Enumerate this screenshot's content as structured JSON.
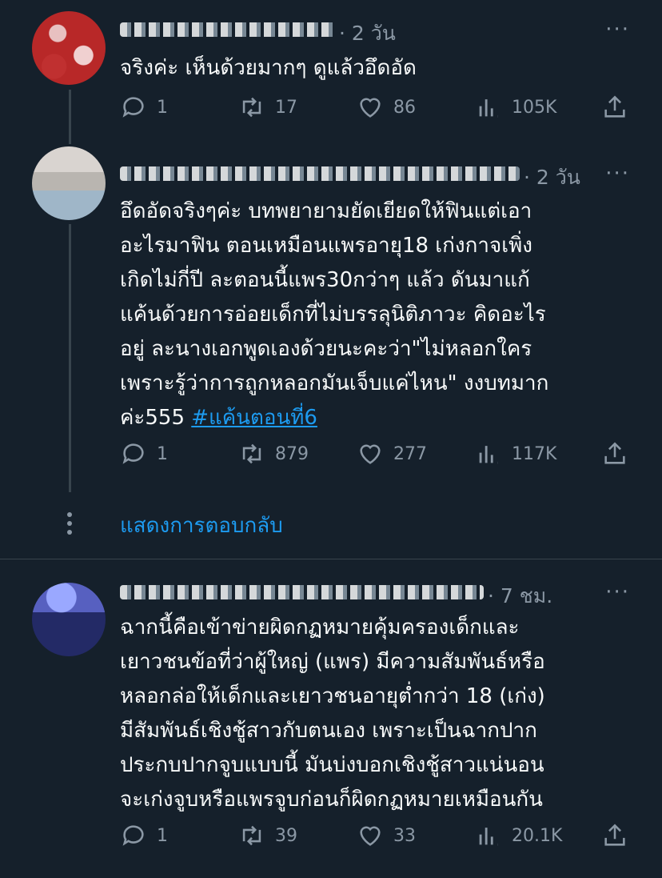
{
  "tweets": [
    {
      "time": "· 2 วัน",
      "text": "จริงค่ะ เห็นด้วยมากๆ ดูแล้วอึดอัด",
      "replies": "1",
      "retweets": "17",
      "likes": "86",
      "views": "105K"
    },
    {
      "time": "· 2 วัน",
      "text": "อึดอัดจริงๆค่ะ บทพยายามยัดเยียดให้ฟินแต่เอา\nอะไรมาฟิน ตอนเหมือนแพรอายุ18 เก่งกาจเพิ่ง\nเกิดไม่กี่ปี ละตอนนี้แพร30กว่าๆ แล้ว ดันมาแก้\nแค้นด้วยการอ่อยเด็กที่ไม่บรรลุนิติภาวะ คิดอะไร\nอยู่ ละนางเอกพูดเองด้วยนะคะว่า\"ไม่หลอกใคร\nเพราะรู้ว่าการถูกหลอกมันเจ็บแค่ไหน\" งงบทมาก\nค่ะ555 ",
      "hashtag": "#แค้นตอนที่6",
      "replies": "1",
      "retweets": "879",
      "likes": "277",
      "views": "117K"
    },
    {
      "time": "· 7 ชม.",
      "text": "ฉากนี้คือเข้าข่ายผิดกฏหมายคุ้มครองเด็กและ\nเยาวชนข้อที่ว่าผู้ใหญ่ (แพร) มีความสัมพันธ์หรือ\nหลอกล่อให้เด็กและเยาวชนอายุต่ำกว่า 18 (เก่ง)\nมีสัมพันธ์เชิงชู้สาวกับตนเอง เพราะเป็นฉากปาก\nประกบปากจูบแบบนี้ มันบ่งบอกเชิงชู้สาวแน่นอน\nจะเก่งจูบหรือแพรจูบก่อนก็ผิดกฏหมายเหมือนกัน",
      "replies": "1",
      "retweets": "39",
      "likes": "33",
      "views": "20.1K"
    }
  ],
  "show_replies": "แสดงการตอบกลับ",
  "more_icon": "···",
  "colors": {
    "background": "#15202b",
    "text": "#f7f9f9",
    "muted": "#8b98a5",
    "link": "#1d9bf0"
  }
}
